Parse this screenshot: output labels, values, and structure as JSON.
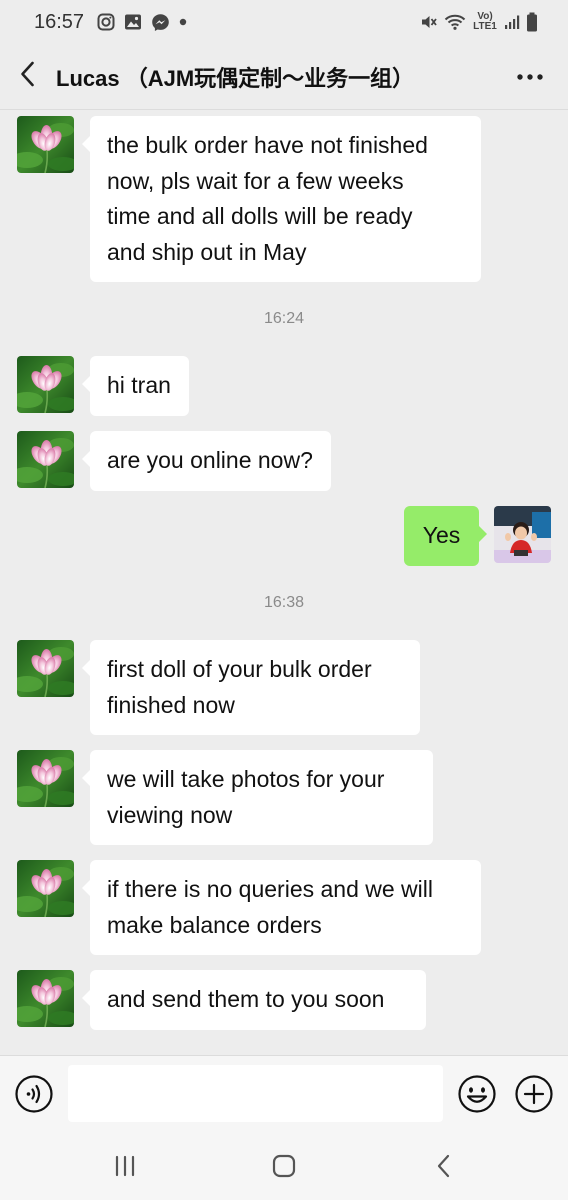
{
  "status_bar": {
    "time": "16:57",
    "network_label": "Vo) LTE1"
  },
  "header": {
    "title": "Lucas （AJM玩偶定制～业务一组）"
  },
  "messages": [
    {
      "side": "left",
      "text": "the bulk order have not finished\nnow, pls wait for a few weeks\ntime and all dolls will be ready\nand ship out in May"
    },
    {
      "type": "timestamp",
      "text": "16:24"
    },
    {
      "side": "left",
      "text": "hi tran"
    },
    {
      "side": "left",
      "text": "are you online now?"
    },
    {
      "side": "right",
      "text": "Yes"
    },
    {
      "type": "timestamp",
      "text": "16:38"
    },
    {
      "side": "left",
      "text": "first doll of your bulk order\nfinished now"
    },
    {
      "side": "left",
      "text": "we will take photos for your\nviewing now"
    },
    {
      "side": "left",
      "text": "if there is no queries and we will\nmake balance orders"
    },
    {
      "side": "left",
      "text": "and send them to you soon"
    }
  ],
  "input": {
    "value": "",
    "placeholder": ""
  },
  "icons": {
    "back": "chevron-left-icon",
    "more": "more-dots-icon",
    "voice": "voice-icon",
    "emoji": "emoji-icon",
    "plus": "plus-icon",
    "nav_recents": "recents-icon",
    "nav_home": "home-icon",
    "nav_back": "nav-back-icon"
  },
  "colors": {
    "background": "#ededed",
    "bubble_left": "#ffffff",
    "bubble_right": "#95ec69",
    "timestamp": "#8a8a8a"
  }
}
